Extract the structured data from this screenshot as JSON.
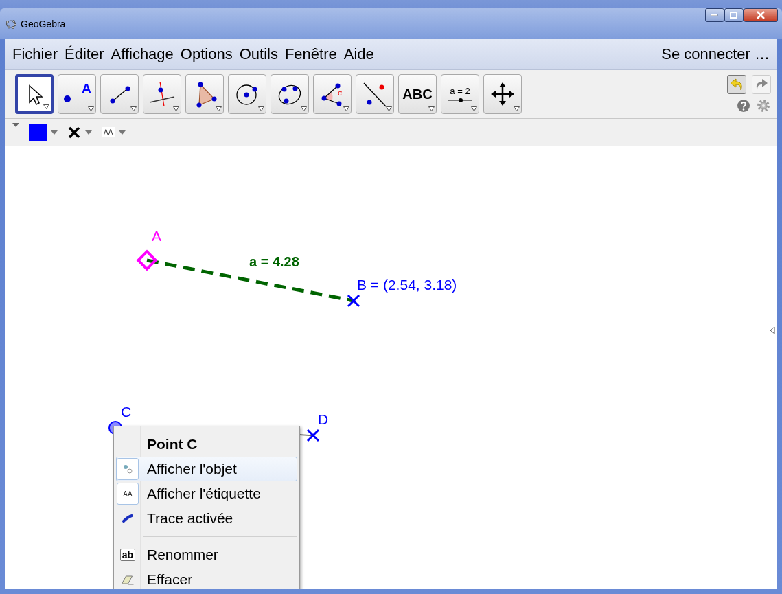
{
  "window": {
    "title": "GeoGebra"
  },
  "menu": [
    {
      "label": "Fichier"
    },
    {
      "label": "Éditer"
    },
    {
      "label": "Affichage"
    },
    {
      "label": "Options"
    },
    {
      "label": "Outils"
    },
    {
      "label": "Fenêtre"
    },
    {
      "label": "Aide"
    }
  ],
  "sign_in": "Se connecter …",
  "tools": [
    {
      "kind": "move",
      "selected": true
    },
    {
      "kind": "point",
      "selected": false,
      "label": "A"
    },
    {
      "kind": "segment",
      "selected": false
    },
    {
      "kind": "perpendicular",
      "selected": false
    },
    {
      "kind": "polygon",
      "selected": false
    },
    {
      "kind": "circle",
      "selected": false
    },
    {
      "kind": "conic",
      "selected": false
    },
    {
      "kind": "angle",
      "selected": false,
      "label": "α"
    },
    {
      "kind": "reflect",
      "selected": false
    },
    {
      "kind": "text",
      "selected": false,
      "label": "ABC"
    },
    {
      "kind": "slider",
      "selected": false,
      "label": "a = 2"
    },
    {
      "kind": "pan",
      "selected": false
    }
  ],
  "style_bar": {
    "color": "#0000ff",
    "label_icon": "AA"
  },
  "canvas": {
    "points": [
      {
        "label": "A",
        "color": "#ff00ff"
      },
      {
        "label": "B = (2.54, 3.18)",
        "color": "#0000ff"
      },
      {
        "label": "C",
        "color": "#0000ff"
      },
      {
        "label": "D",
        "color": "#0000ff"
      }
    ],
    "segment_label": "a = 4.28"
  },
  "context_menu": {
    "title": "Point C",
    "items": [
      {
        "kind": "toggle",
        "label": "Afficher l'objet",
        "checked": true,
        "selected": true
      },
      {
        "kind": "toggle",
        "icon_text": "AA",
        "label": "Afficher l'étiquette",
        "checked": true,
        "selected": false
      },
      {
        "kind": "toggle",
        "label": "Trace activée",
        "checked": false,
        "selected": false
      },
      {
        "kind": "separator"
      },
      {
        "kind": "action",
        "icon_text": "ab",
        "label": "Renommer",
        "selected": false
      },
      {
        "kind": "action",
        "label": "Effacer",
        "selected": false
      }
    ]
  }
}
